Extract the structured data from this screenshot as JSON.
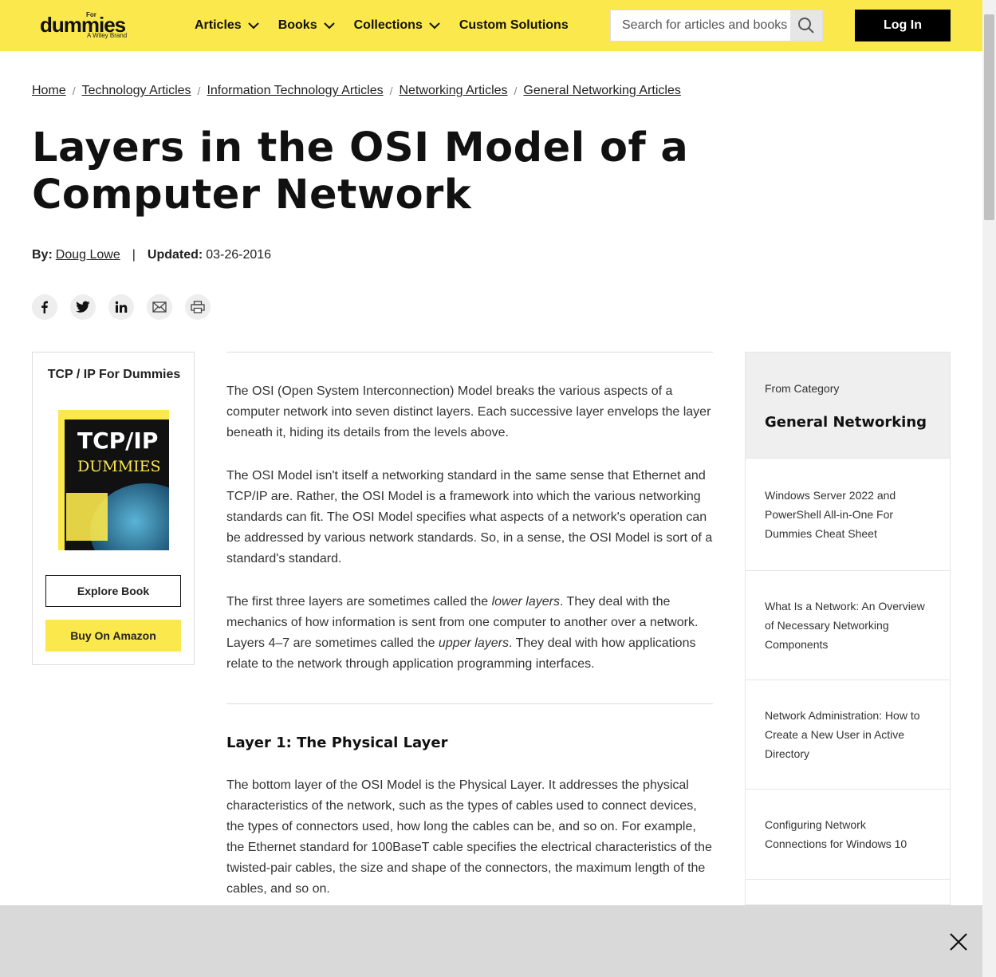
{
  "header": {
    "logo": {
      "for": "For",
      "word": "dummies",
      "brand": "A Wiley Brand"
    },
    "nav": [
      {
        "label": "Articles",
        "dropdown": true
      },
      {
        "label": "Books",
        "dropdown": true
      },
      {
        "label": "Collections",
        "dropdown": true
      },
      {
        "label": "Custom Solutions",
        "dropdown": false
      }
    ],
    "search_placeholder": "Search for articles and books",
    "login_label": "Log In"
  },
  "breadcrumb": [
    "Home",
    "Technology Articles",
    "Information Technology Articles",
    "Networking Articles",
    "General Networking Articles"
  ],
  "article": {
    "title": "Layers in the OSI Model of a Computer Network",
    "by_label": "By:",
    "author": "Doug Lowe",
    "updated_label": "Updated:",
    "updated": "03-26-2016",
    "share_icons": [
      "facebook-icon",
      "twitter-icon",
      "linkedin-icon",
      "email-icon",
      "print-icon"
    ],
    "paragraphs": [
      "The OSI (Open System Interconnection) Model breaks the various aspects of a computer network into seven distinct layers. Each successive layer envelops the layer beneath it, hiding its details from the levels above.",
      "The OSI Model isn't itself a networking standard in the same sense that Ethernet and TCP/IP are. Rather, the OSI Model is a framework into which the various networking standards can fit. The OSI Model specifies what aspects of a network's operation can be addressed by various network standards. So, in a sense, the OSI Model is sort of a standard's standard."
    ],
    "p3": {
      "a": "The first three layers are sometimes called the ",
      "em1": "lower layers",
      "b": ". They deal with the mechanics of how information is sent from one computer to another over a network. Layers 4–7 are sometimes called the ",
      "em2": "upper layers",
      "c": ". They deal with how applications relate to the network through application programming interfaces."
    },
    "section_heading": "Layer 1: The Physical Layer",
    "section_paragraph": "The bottom layer of the OSI Model is the Physical Layer. It addresses the physical characteristics of the network, such as the types of cables used to connect devices, the types of connectors used, how long the cables can be, and so on. For example, the Ethernet standard for 100BaseT cable specifies the electrical characteristics of the twisted-pair cables, the size and shape of the connectors, the maximum length of the cables, and so on."
  },
  "book": {
    "title": "TCP / IP For Dummies",
    "cover_title": "TCP/IP",
    "cover_sub": "DUMMIES",
    "explore_label": "Explore Book",
    "amazon_label": "Buy On Amazon"
  },
  "sidebar": {
    "from_label": "From Category",
    "category": "General Networking",
    "items": [
      "Windows Server 2022 and PowerShell All-in-One For Dummies Cheat Sheet",
      "What Is a Network: An Overview of Necessary Networking Components",
      "Network Administration: How to Create a New User in Active Directory",
      "Configuring Network Connections for Windows 10"
    ]
  },
  "colors": {
    "accent": "#fbe84d",
    "dark": "#000000"
  }
}
